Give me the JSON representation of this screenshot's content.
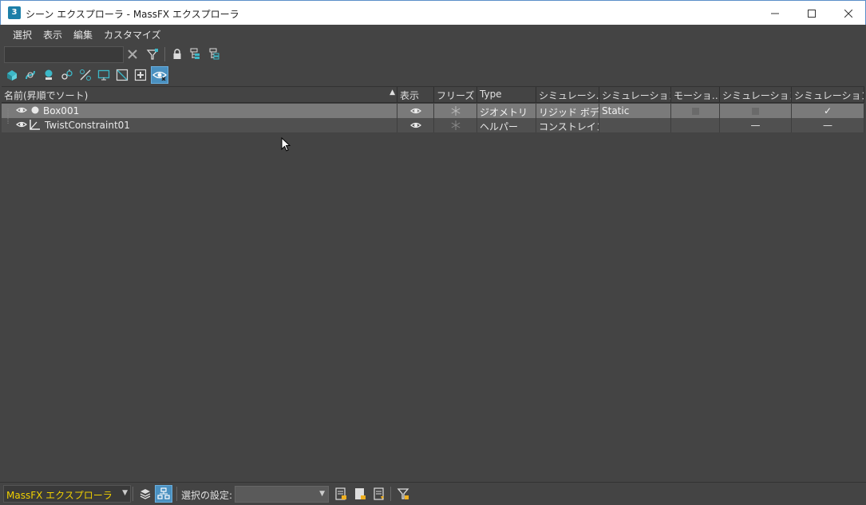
{
  "window": {
    "title": "シーン エクスプローラ - MassFX エクスプローラ",
    "app_icon_label": "3",
    "controls": [
      "minimize-icon",
      "maximize-icon",
      "close-icon"
    ]
  },
  "menu": {
    "items": [
      "選択",
      "表示",
      "編集",
      "カスタマイズ"
    ]
  },
  "toolbar": {
    "search_value": "",
    "icons": [
      "clear-search-icon",
      "filter-icon",
      "lock-icon",
      "hierarchy-expand-icon",
      "hierarchy-collapse-icon"
    ]
  },
  "filter_toolbar": {
    "icons": [
      "display-geometry-icon",
      "display-shapes-icon",
      "display-lights-icon",
      "display-cameras-icon",
      "display-helpers-icon",
      "display-spacewarps-icon",
      "display-groups-icon",
      "display-xrefs-icon",
      "display-all-icon"
    ],
    "active_icon": "display-all-icon"
  },
  "table": {
    "headers": {
      "name": "名前(昇順でソート)",
      "sort_arrow": "▲",
      "display": "表示",
      "freeze": "フリーズ",
      "type": "Type",
      "sim1": "シミュレーシ…",
      "sim2": "シミュレーション…",
      "motion": "モーショ…",
      "sim3": "シミュレーション…",
      "sim4": "シミュレーション…"
    },
    "rows": [
      {
        "name": "Box001",
        "display_icon": "eye-icon",
        "freeze_icon": "snowflake-icon",
        "type": "ジオメトリ",
        "sim1": "リジッド ボディ",
        "sim2": "Static",
        "motion": "square",
        "sim3": "square",
        "sim4": "✓",
        "selected": true
      },
      {
        "name": "TwistConstraint01",
        "display_icon": "eye-icon",
        "freeze_icon": "snowflake-icon",
        "type": "ヘルパー",
        "sim1": "コンストレイント",
        "sim2": "",
        "motion": "",
        "sim3": "—",
        "sim4": "—",
        "selected": false
      }
    ]
  },
  "bottombar": {
    "explorer_name": "MassFX エクスプローラ",
    "selection_label": "選択の設定:",
    "selection_value": "",
    "icons": [
      "layers-icon",
      "hierarchy-icon",
      "selection-set-icon",
      "add-selection-icon",
      "remove-selection-icon",
      "filter-selection-icon"
    ]
  },
  "colors": {
    "background": "#444444",
    "selected_row": "#7a7a7a",
    "accent": "#4a90c0",
    "explorer_name": "#f0d000"
  }
}
